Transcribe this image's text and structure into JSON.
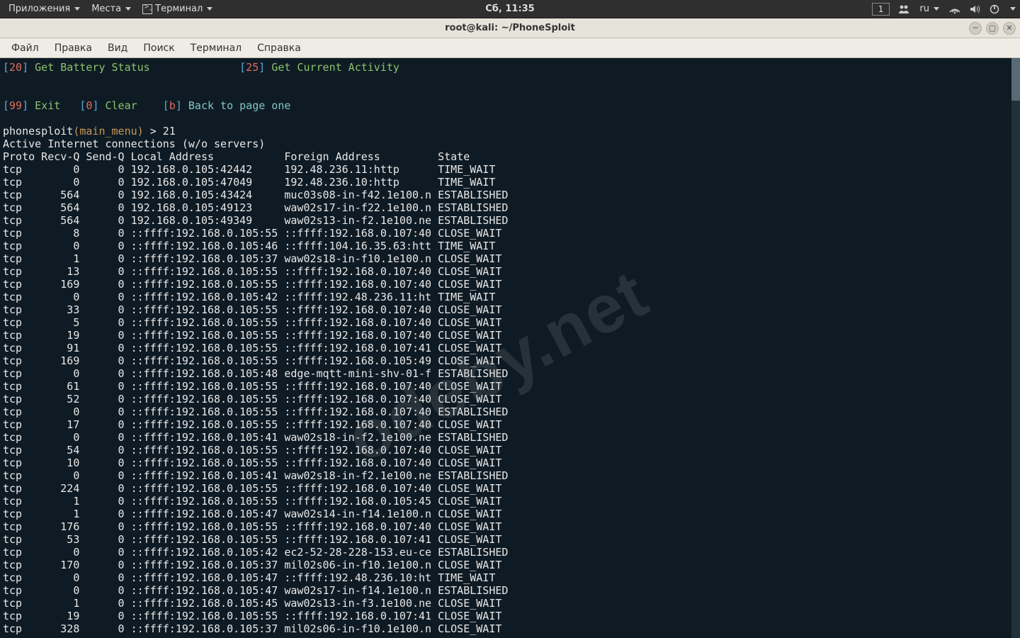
{
  "panel": {
    "apps": "Приложения",
    "places": "Места",
    "terminal": "Терминал",
    "clock": "Сб, 11:35",
    "workspace": "1",
    "locale": "ru"
  },
  "window": {
    "title": "root@kali: ~/PhoneSploit",
    "file": "Файл",
    "edit": "Правка",
    "view": "Вид",
    "search": "Поиск",
    "terminal": "Терминал",
    "help": "Справка"
  },
  "menu_opts": {
    "a_code": "20",
    "a_label": "Get Battery Status",
    "b_code": "25",
    "b_label": "Get Current Activity",
    "exit_code": "99",
    "exit_label": "Exit",
    "clear_code": "0",
    "clear_label": "Clear",
    "back_code": "b",
    "back_label": "Back to page one"
  },
  "prompt": {
    "app": "phonesploit",
    "scope": "(main_menu)",
    "arrow": ">",
    "input": "21",
    "l1": "Active Internet connections (w/o servers)",
    "l2": "Proto Recv-Q Send-Q Local Address           Foreign Address         State"
  },
  "rows": [
    [
      "tcp",
      "0",
      "0",
      "192.168.0.105:42442",
      "192.48.236.11:http",
      "TIME_WAIT"
    ],
    [
      "tcp",
      "0",
      "0",
      "192.168.0.105:47049",
      "192.48.236.10:http",
      "TIME_WAIT"
    ],
    [
      "tcp",
      "564",
      "0",
      "192.168.0.105:43424",
      "muc03s08-in-f42.1e100.n",
      "ESTABLISHED"
    ],
    [
      "tcp",
      "564",
      "0",
      "192.168.0.105:49123",
      "waw02s17-in-f22.1e100.n",
      "ESTABLISHED"
    ],
    [
      "tcp",
      "564",
      "0",
      "192.168.0.105:49349",
      "waw02s13-in-f2.1e100.ne",
      "ESTABLISHED"
    ],
    [
      "tcp",
      "8",
      "0",
      "::ffff:192.168.0.105:55",
      "::ffff:192.168.0.107:40",
      "CLOSE_WAIT"
    ],
    [
      "tcp",
      "0",
      "0",
      "::ffff:192.168.0.105:46",
      "::ffff:104.16.35.63:htt",
      "TIME_WAIT"
    ],
    [
      "tcp",
      "1",
      "0",
      "::ffff:192.168.0.105:37",
      "waw02s18-in-f10.1e100.n",
      "CLOSE_WAIT"
    ],
    [
      "tcp",
      "13",
      "0",
      "::ffff:192.168.0.105:55",
      "::ffff:192.168.0.107:40",
      "CLOSE_WAIT"
    ],
    [
      "tcp",
      "169",
      "0",
      "::ffff:192.168.0.105:55",
      "::ffff:192.168.0.107:40",
      "CLOSE_WAIT"
    ],
    [
      "tcp",
      "0",
      "0",
      "::ffff:192.168.0.105:42",
      "::ffff:192.48.236.11:ht",
      "TIME_WAIT"
    ],
    [
      "tcp",
      "33",
      "0",
      "::ffff:192.168.0.105:55",
      "::ffff:192.168.0.107:40",
      "CLOSE_WAIT"
    ],
    [
      "tcp",
      "5",
      "0",
      "::ffff:192.168.0.105:55",
      "::ffff:192.168.0.107:40",
      "CLOSE_WAIT"
    ],
    [
      "tcp",
      "19",
      "0",
      "::ffff:192.168.0.105:55",
      "::ffff:192.168.0.107:40",
      "CLOSE_WAIT"
    ],
    [
      "tcp",
      "91",
      "0",
      "::ffff:192.168.0.105:55",
      "::ffff:192.168.0.107:41",
      "CLOSE_WAIT"
    ],
    [
      "tcp",
      "169",
      "0",
      "::ffff:192.168.0.105:55",
      "::ffff:192.168.0.105:49",
      "CLOSE_WAIT"
    ],
    [
      "tcp",
      "0",
      "0",
      "::ffff:192.168.0.105:48",
      "edge-mqtt-mini-shv-01-f",
      "ESTABLISHED"
    ],
    [
      "tcp",
      "61",
      "0",
      "::ffff:192.168.0.105:55",
      "::ffff:192.168.0.107:40",
      "CLOSE_WAIT"
    ],
    [
      "tcp",
      "52",
      "0",
      "::ffff:192.168.0.105:55",
      "::ffff:192.168.0.107:40",
      "CLOSE_WAIT"
    ],
    [
      "tcp",
      "0",
      "0",
      "::ffff:192.168.0.105:55",
      "::ffff:192.168.0.107:40",
      "ESTABLISHED"
    ],
    [
      "tcp",
      "17",
      "0",
      "::ffff:192.168.0.105:55",
      "::ffff:192.168.0.107:40",
      "CLOSE_WAIT"
    ],
    [
      "tcp",
      "0",
      "0",
      "::ffff:192.168.0.105:41",
      "waw02s18-in-f2.1e100.ne",
      "ESTABLISHED"
    ],
    [
      "tcp",
      "54",
      "0",
      "::ffff:192.168.0.105:55",
      "::ffff:192.168.0.107:40",
      "CLOSE_WAIT"
    ],
    [
      "tcp",
      "10",
      "0",
      "::ffff:192.168.0.105:55",
      "::ffff:192.168.0.107:40",
      "CLOSE_WAIT"
    ],
    [
      "tcp",
      "0",
      "0",
      "::ffff:192.168.0.105:41",
      "waw02s18-in-f2.1e100.ne",
      "ESTABLISHED"
    ],
    [
      "tcp",
      "224",
      "0",
      "::ffff:192.168.0.105:55",
      "::ffff:192.168.0.107:40",
      "CLOSE_WAIT"
    ],
    [
      "tcp",
      "1",
      "0",
      "::ffff:192.168.0.105:55",
      "::ffff:192.168.0.105:45",
      "CLOSE_WAIT"
    ],
    [
      "tcp",
      "1",
      "0",
      "::ffff:192.168.0.105:47",
      "waw02s14-in-f14.1e100.n",
      "CLOSE_WAIT"
    ],
    [
      "tcp",
      "176",
      "0",
      "::ffff:192.168.0.105:55",
      "::ffff:192.168.0.107:40",
      "CLOSE_WAIT"
    ],
    [
      "tcp",
      "53",
      "0",
      "::ffff:192.168.0.105:55",
      "::ffff:192.168.0.107:41",
      "CLOSE_WAIT"
    ],
    [
      "tcp",
      "0",
      "0",
      "::ffff:192.168.0.105:42",
      "ec2-52-28-228-153.eu-ce",
      "ESTABLISHED"
    ],
    [
      "tcp",
      "170",
      "0",
      "::ffff:192.168.0.105:37",
      "mil02s06-in-f10.1e100.n",
      "CLOSE_WAIT"
    ],
    [
      "tcp",
      "0",
      "0",
      "::ffff:192.168.0.105:47",
      "::ffff:192.48.236.10:ht",
      "TIME_WAIT"
    ],
    [
      "tcp",
      "0",
      "0",
      "::ffff:192.168.0.105:47",
      "waw02s17-in-f14.1e100.n",
      "ESTABLISHED"
    ],
    [
      "tcp",
      "1",
      "0",
      "::ffff:192.168.0.105:45",
      "waw02s13-in-f3.1e100.ne",
      "CLOSE_WAIT"
    ],
    [
      "tcp",
      "19",
      "0",
      "::ffff:192.168.0.105:55",
      "::ffff:192.168.0.107:41",
      "CLOSE_WAIT"
    ],
    [
      "tcp",
      "328",
      "0",
      "::ffff:192.168.0.105:37",
      "mil02s06-in-f10.1e100.n",
      "CLOSE_WAIT"
    ]
  ],
  "watermark": "odeby.net"
}
